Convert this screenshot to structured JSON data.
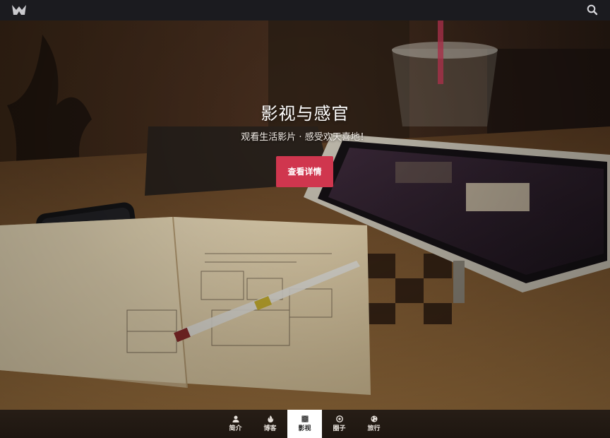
{
  "topbar": {
    "logo_icon": "m-logo-icon",
    "search_icon": "search-icon"
  },
  "hero": {
    "title": "影视与感官",
    "subtitle": "观看生活影片 · 感受欢天喜地！",
    "button_label": "查看详情"
  },
  "nav": {
    "items": [
      {
        "label": "简介",
        "icon": "person-icon",
        "active": false
      },
      {
        "label": "博客",
        "icon": "flame-icon",
        "active": false
      },
      {
        "label": "影视",
        "icon": "film-icon",
        "active": true
      },
      {
        "label": "圈子",
        "icon": "circle-target-icon",
        "active": false
      },
      {
        "label": "旅行",
        "icon": "globe-icon",
        "active": false
      }
    ]
  },
  "colors": {
    "topbar_bg": "#1b1b1f",
    "accent": "#d0364e",
    "nav_active_bg": "#ffffff"
  }
}
